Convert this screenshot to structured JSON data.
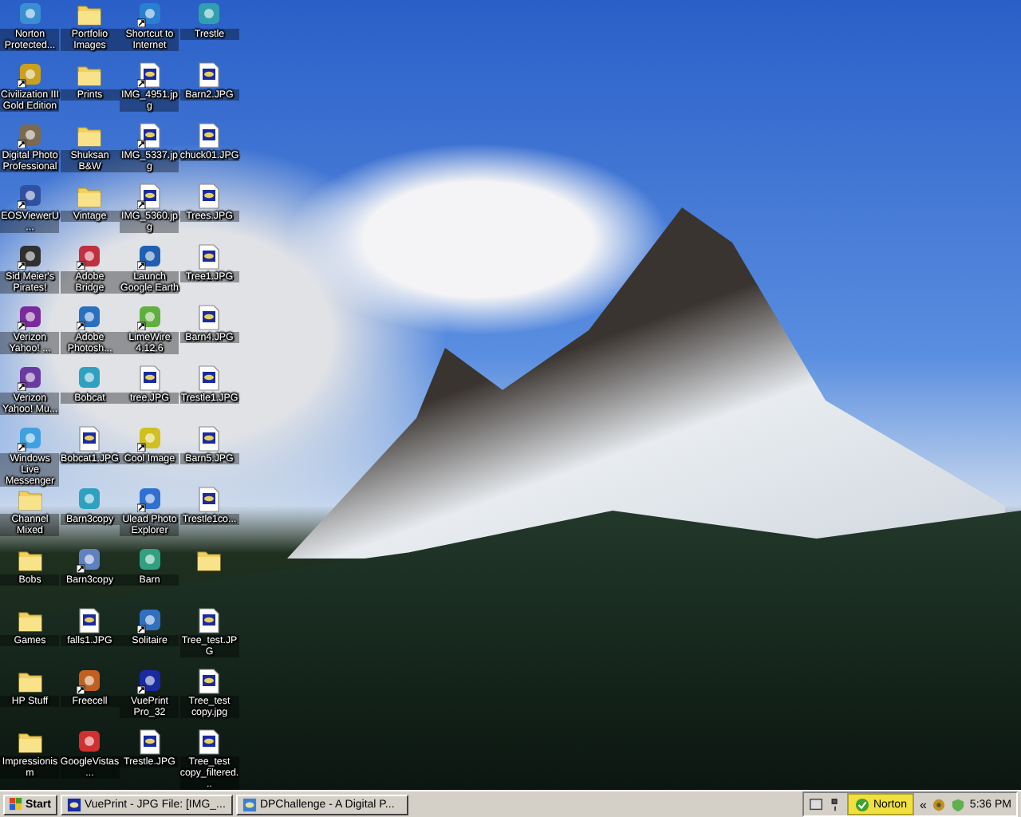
{
  "desktop": {
    "columns": [
      [
        {
          "kind": "app",
          "label": "Norton Protected...",
          "shortcut": false,
          "color": "#3a8fd0"
        },
        {
          "kind": "app",
          "label": "Civilization III Gold Edition",
          "shortcut": true,
          "color": "#c9a020"
        },
        {
          "kind": "app",
          "label": "Digital Photo Professional",
          "shortcut": true,
          "color": "#7a6a50"
        },
        {
          "kind": "app",
          "label": "EOSViewerU...",
          "shortcut": true,
          "color": "#3050a0"
        },
        {
          "kind": "app",
          "label": "Sid Meier's Pirates!",
          "shortcut": true,
          "color": "#303030"
        },
        {
          "kind": "app",
          "label": "Verizon Yahoo! ...",
          "shortcut": true,
          "color": "#7a2a9a"
        },
        {
          "kind": "app",
          "label": "Verizon Yahoo! Mu...",
          "shortcut": true,
          "color": "#6a3aa0"
        },
        {
          "kind": "app",
          "label": "Windows Live Messenger",
          "shortcut": true,
          "color": "#40a0e0"
        },
        {
          "kind": "folder",
          "label": "Channel Mixed",
          "shortcut": false
        },
        {
          "kind": "folder",
          "label": "Bobs",
          "shortcut": false
        },
        {
          "kind": "folder",
          "label": "Games",
          "shortcut": false
        },
        {
          "kind": "folder",
          "label": "HP Stuff",
          "shortcut": false
        },
        {
          "kind": "folder",
          "label": "Impressionism",
          "shortcut": false
        }
      ],
      [
        {
          "kind": "folder",
          "label": "Portfolio Images",
          "shortcut": false
        },
        {
          "kind": "folder",
          "label": "Prints",
          "shortcut": false
        },
        {
          "kind": "folder",
          "label": "Shuksan B&W",
          "shortcut": false
        },
        {
          "kind": "folder",
          "label": "Vintage",
          "shortcut": false
        },
        {
          "kind": "app",
          "label": "Adobe Bridge",
          "shortcut": true,
          "color": "#c03040"
        },
        {
          "kind": "app",
          "label": "Adobe Photosh...",
          "shortcut": true,
          "color": "#2a70c0"
        },
        {
          "kind": "app",
          "label": "Bobcat",
          "shortcut": false,
          "color": "#30a0c0"
        },
        {
          "kind": "image",
          "label": "Bobcat1.JPG",
          "shortcut": false
        },
        {
          "kind": "app",
          "label": "Barn3copy",
          "shortcut": false,
          "color": "#30a0c0"
        },
        {
          "kind": "app",
          "label": "Barn3copy",
          "shortcut": true,
          "color": "#6080c0"
        },
        {
          "kind": "image",
          "label": "falls1.JPG",
          "shortcut": false
        },
        {
          "kind": "app",
          "label": "Freecell",
          "shortcut": true,
          "color": "#c06020"
        },
        {
          "kind": "app",
          "label": "GoogleVistas...",
          "shortcut": false,
          "color": "#d03030"
        }
      ],
      [
        {
          "kind": "app",
          "label": "Shortcut to Internet",
          "shortcut": true,
          "color": "#2a80d0"
        },
        {
          "kind": "image",
          "label": "IMG_4951.jpg",
          "shortcut": true
        },
        {
          "kind": "image",
          "label": "IMG_5337.jpg",
          "shortcut": true
        },
        {
          "kind": "image",
          "label": "IMG_5360.jpg",
          "shortcut": true
        },
        {
          "kind": "app",
          "label": "Launch Google Earth",
          "shortcut": true,
          "color": "#2060b0"
        },
        {
          "kind": "app",
          "label": "LimeWire 4.12.6",
          "shortcut": true,
          "color": "#60b040"
        },
        {
          "kind": "image",
          "label": "tree.JPG",
          "shortcut": false
        },
        {
          "kind": "app",
          "label": "Cool Image",
          "shortcut": true,
          "color": "#d0c020"
        },
        {
          "kind": "app",
          "label": "Ulead Photo Explorer",
          "shortcut": true,
          "color": "#3070d0"
        },
        {
          "kind": "app",
          "label": "Barn",
          "shortcut": false,
          "color": "#30a080"
        },
        {
          "kind": "app",
          "label": "Solitaire",
          "shortcut": true,
          "color": "#3070c0"
        },
        {
          "kind": "app",
          "label": "VuePrint Pro_32",
          "shortcut": true,
          "color": "#1a2aa0"
        },
        {
          "kind": "image",
          "label": "Trestle.JPG",
          "shortcut": false
        }
      ],
      [
        {
          "kind": "app",
          "label": "Trestle",
          "shortcut": false,
          "color": "#30a0b0"
        },
        {
          "kind": "image",
          "label": "Barn2.JPG",
          "shortcut": false
        },
        {
          "kind": "image",
          "label": "chuck01.JPG",
          "shortcut": false
        },
        {
          "kind": "image",
          "label": "Trees.JPG",
          "shortcut": false
        },
        {
          "kind": "image",
          "label": "Tree1.JPG",
          "shortcut": false
        },
        {
          "kind": "image",
          "label": "Barn4.JPG",
          "shortcut": false
        },
        {
          "kind": "image",
          "label": "Trestle1.JPG",
          "shortcut": false
        },
        {
          "kind": "image",
          "label": "Barn5.JPG",
          "shortcut": false
        },
        {
          "kind": "image",
          "label": "Trestle1co...",
          "shortcut": false
        },
        {
          "kind": "folder",
          "shortcut": false
        },
        {
          "kind": "image",
          "label": "Tree_test.JPG",
          "shortcut": false
        },
        {
          "kind": "image",
          "label": "Tree_test copy.jpg",
          "shortcut": false
        },
        {
          "kind": "image",
          "label": "Tree_test copy_filtered...",
          "shortcut": false
        }
      ]
    ]
  },
  "taskbar": {
    "start": "Start",
    "tasks": [
      {
        "label": "VuePrint - JPG File: [IMG_...",
        "selected": false
      },
      {
        "label": "DPChallenge - A Digital P...",
        "selected": false
      }
    ],
    "norton": "Norton",
    "expand": "«",
    "clock": "5:36 PM"
  }
}
